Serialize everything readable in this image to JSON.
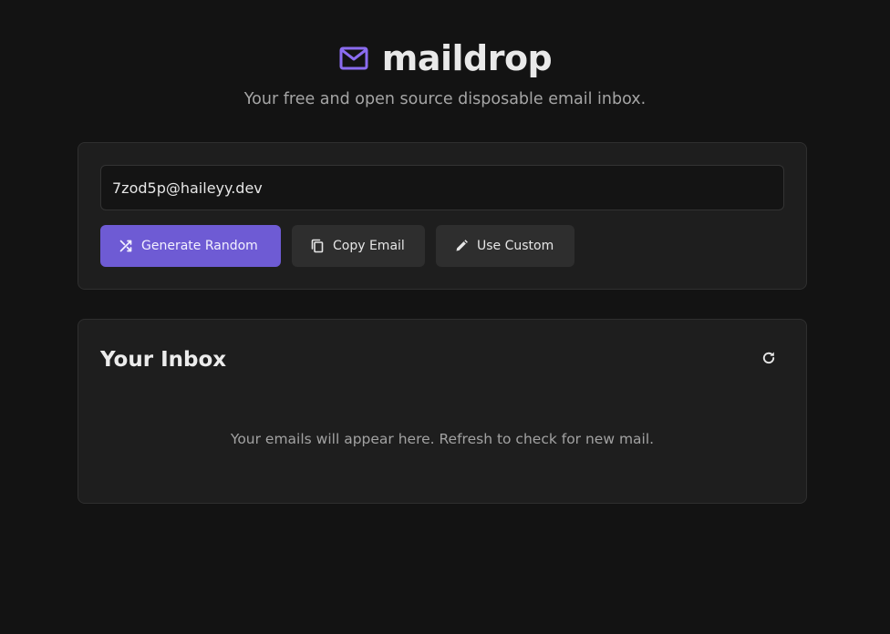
{
  "brand": {
    "title": "maildrop",
    "icon": "mail-icon",
    "accent_color": "#8b6cf0"
  },
  "tagline": "Your free and open source disposable email inbox.",
  "email": {
    "value": "7zod5p@haileyy.dev"
  },
  "actions": {
    "generate_label": "Generate Random",
    "generate_icon": "shuffle-icon",
    "copy_label": "Copy Email",
    "copy_icon": "copy-icon",
    "custom_label": "Use Custom",
    "custom_icon": "pencil-icon"
  },
  "inbox": {
    "title": "Your Inbox",
    "refresh_icon": "refresh-icon",
    "empty_message": "Your emails will appear here. Refresh to check for new mail."
  },
  "colors": {
    "background": "#131313",
    "card": "#1e1e1e",
    "primary_button": "#6e5bd4",
    "secondary_button": "#2e2e2e"
  }
}
